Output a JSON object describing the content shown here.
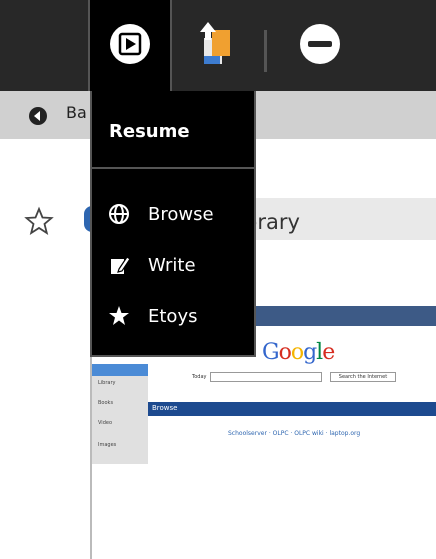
{
  "toolbar": {
    "items": [
      {
        "icon": "resume-activity-icon",
        "active": true
      },
      {
        "icon": "keep-journal-icon",
        "active": false
      },
      {
        "icon": "stop-icon",
        "active": false
      }
    ]
  },
  "secondary_bar": {
    "back_label": "Ba"
  },
  "page": {
    "title_visible": "brary"
  },
  "menu": {
    "resume_label": "Resume",
    "items": [
      {
        "label": "Browse",
        "icon": "browse-globe-icon"
      },
      {
        "label": "Write",
        "icon": "write-pencil-icon"
      },
      {
        "label": "Etoys",
        "icon": "etoys-star-icon"
      }
    ]
  },
  "thumbnail": {
    "logo": "Google",
    "search_label": "Today",
    "search_button": "Search the Internet",
    "browse_label": "Browse",
    "links": "Schoolserver · OLPC · OLPC wiki · laptop.org",
    "sidebar": [
      "Library",
      "Books",
      "Video",
      "Images"
    ]
  },
  "colors": {
    "toolbar_bg": "#282828",
    "menu_bg": "#000000",
    "accent_blue": "#2e66b0"
  }
}
